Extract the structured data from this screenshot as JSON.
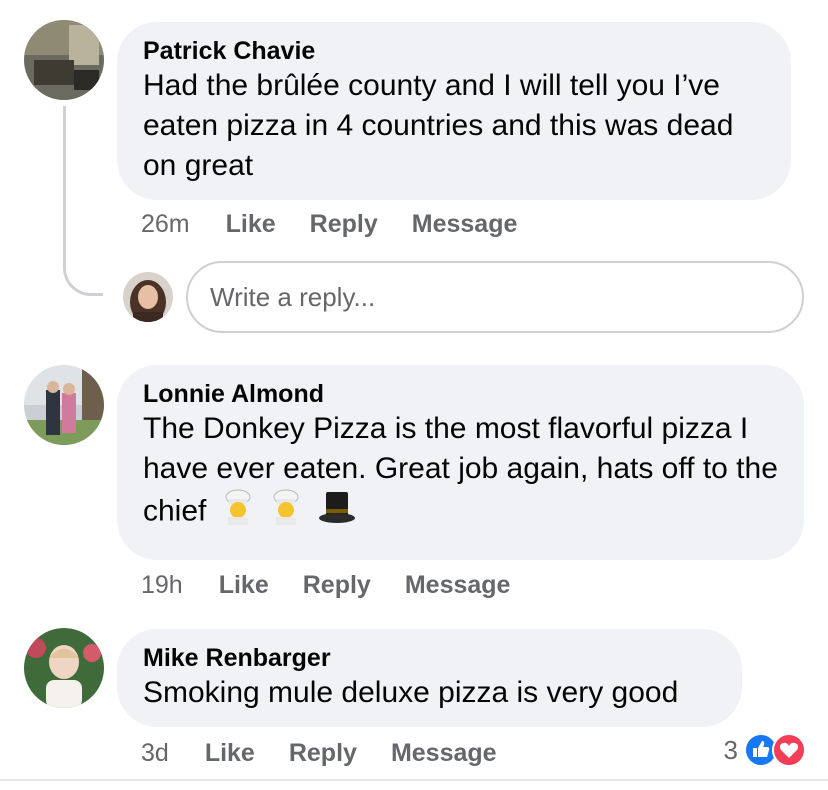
{
  "comments": [
    {
      "author": "Patrick Chavie",
      "text": "Had the brûlée county and I will tell you I’ve eaten pizza in 4 countries and this was dead on great",
      "time": "26m",
      "actions": [
        "Like",
        "Reply",
        "Message"
      ]
    },
    {
      "author": "Lonnie Almond",
      "text": "The Donkey Pizza is the most flavorful pizza I have ever eaten. Great job again, hats off to the chief",
      "emoji": [
        "cook-emoji",
        "cook-emoji",
        "top-hat-emoji"
      ],
      "time": "19h",
      "actions": [
        "Like",
        "Reply",
        "Message"
      ]
    },
    {
      "author": "Mike Renbarger",
      "text": "Smoking mule deluxe pizza is very good",
      "time": "3d",
      "actions": [
        "Like",
        "Reply",
        "Message"
      ],
      "reaction_count": "3",
      "reaction_icons": [
        "like-reaction-icon",
        "love-reaction-icon"
      ]
    }
  ],
  "reply_box": {
    "placeholder": "Write a reply..."
  },
  "colors": {
    "bubble": "#f0f2f5",
    "meta_text": "#65676b",
    "like_blue": "#1877f2",
    "love_red": "#f33e58"
  }
}
